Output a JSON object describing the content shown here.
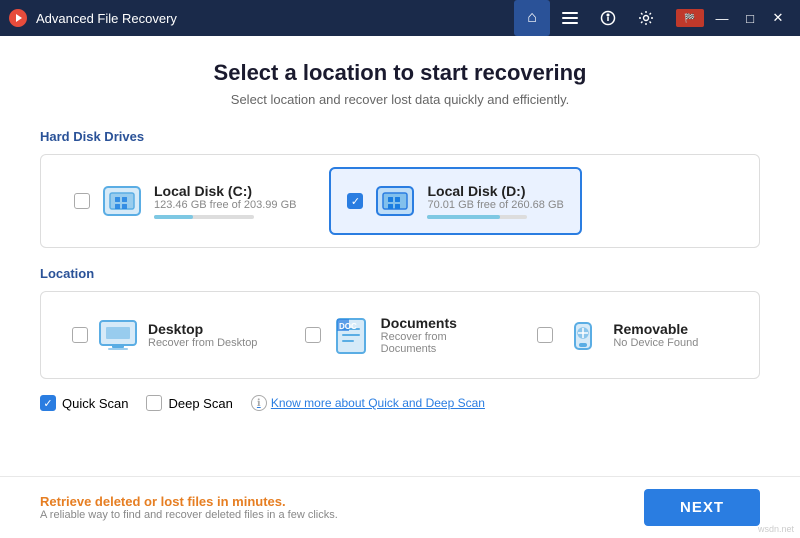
{
  "titleBar": {
    "appName": "Advanced File Recovery",
    "navButtons": [
      {
        "id": "home",
        "icon": "⌂",
        "active": true
      },
      {
        "id": "list",
        "icon": "☰",
        "active": false
      },
      {
        "id": "info",
        "icon": "ℹ",
        "active": false
      },
      {
        "id": "settings",
        "icon": "⚙",
        "active": false
      }
    ],
    "controls": {
      "minimize": "—",
      "maximize": "□",
      "close": "✕"
    }
  },
  "page": {
    "title": "Select a location to start recovering",
    "subtitle": "Select location and recover lost data quickly and efficiently."
  },
  "hardDiskDrives": {
    "sectionLabel": "Hard Disk Drives",
    "drives": [
      {
        "name": "Local Disk (C:)",
        "size": "123.46 GB free of 203.99 GB",
        "fillPercent": 39,
        "selected": false
      },
      {
        "name": "Local Disk (D:)",
        "size": "70.01 GB free of 260.68 GB",
        "fillPercent": 73,
        "selected": true
      }
    ]
  },
  "location": {
    "sectionLabel": "Location",
    "items": [
      {
        "name": "Desktop",
        "desc": "Recover from Desktop",
        "selected": false,
        "type": "desktop"
      },
      {
        "name": "Documents",
        "desc": "Recover from Documents",
        "selected": false,
        "type": "documents"
      },
      {
        "name": "Removable",
        "desc": "No Device Found",
        "selected": false,
        "type": "usb"
      }
    ]
  },
  "scanOptions": {
    "quickScan": {
      "label": "Quick Scan",
      "checked": true
    },
    "deepScan": {
      "label": "Deep Scan",
      "checked": false
    },
    "learnMoreLink": "Know more about Quick and Deep Scan"
  },
  "footer": {
    "title": "Retrieve deleted or lost files in minutes.",
    "desc": "A reliable way to find and recover deleted files in a few clicks.",
    "nextButton": "NEXT"
  },
  "watermark": "wsdn.net"
}
